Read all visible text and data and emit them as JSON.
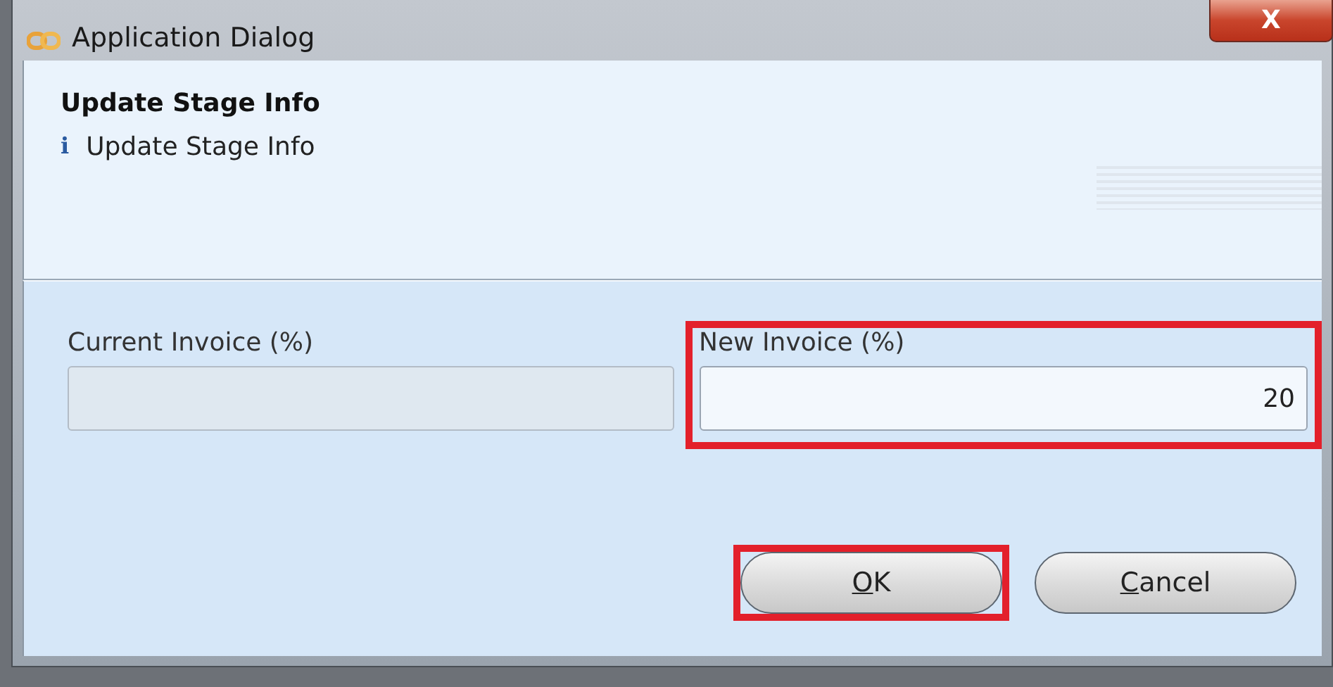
{
  "window": {
    "title": "Application Dialog",
    "close_label": "X"
  },
  "header": {
    "title": "Update Stage Info",
    "message": "Update Stage Info",
    "message_icon": "i"
  },
  "fields": [
    {
      "label": "Current Invoice (%)",
      "disabled": true,
      "highlighted": false
    },
    {
      "label": "New Invoice (%)",
      "value": "20",
      "disabled": false,
      "highlighted": true
    }
  ],
  "buttons": [
    {
      "label": "OK",
      "mnemonic_first": true,
      "highlighted": true
    },
    {
      "label": "Cancel",
      "mnemonic_first": true,
      "highlighted": false
    }
  ]
}
